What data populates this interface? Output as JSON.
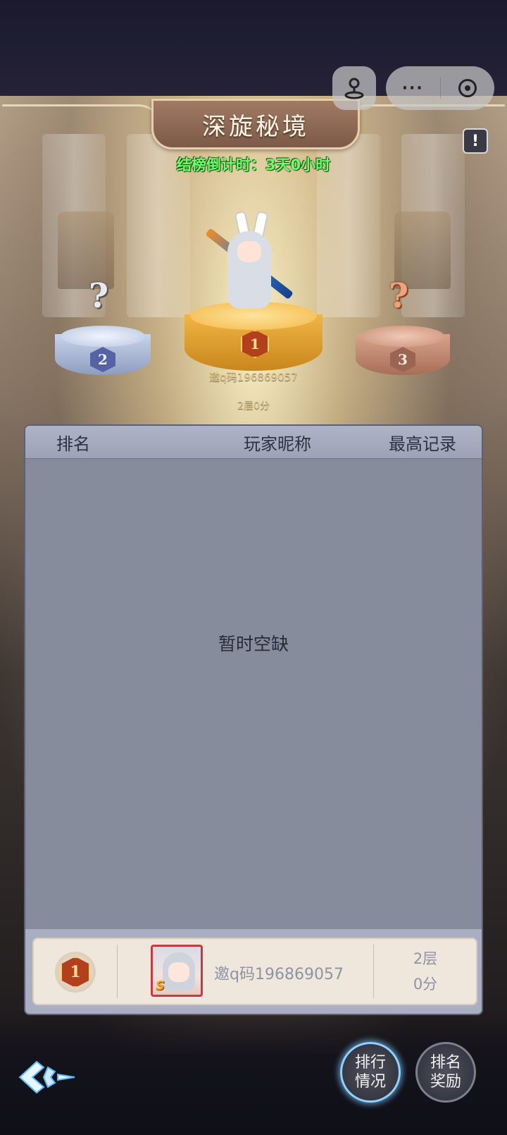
{
  "header": {
    "title": "深旋秘境",
    "countdown": "结榜倒计时：3天0小时"
  },
  "mini_program_bar": {
    "icons": [
      "joystick-icon",
      "more-dots-icon",
      "close-target-icon"
    ],
    "more_label": "···"
  },
  "info_button": {
    "label": "!"
  },
  "podium": {
    "first": {
      "rank": "1",
      "name": "邀q码196869057",
      "score": "2层0分"
    },
    "second": {
      "rank": "2",
      "name": "?",
      "unknown": true
    },
    "third": {
      "rank": "3",
      "name": "?",
      "unknown": true
    }
  },
  "ranking_table": {
    "columns": [
      "排名",
      "玩家昵称",
      "最高记录"
    ],
    "empty_text": "暂时空缺",
    "rows": []
  },
  "my_rank": {
    "rank": "1",
    "avatar_grade": "S",
    "name": "邀q码196869057",
    "floor": "2层",
    "score": "0分"
  },
  "bottom_buttons": {
    "ranking_status": {
      "line1": "排行",
      "line2": "情况"
    },
    "ranking_rewards": {
      "line1": "排名",
      "line2": "奖励"
    }
  },
  "colors": {
    "countdown_green": "#6cff6a",
    "gold": "#f1b545",
    "silver": "#c9d4ea",
    "bronze": "#d7a38b",
    "panel_bg": "#878c9c"
  }
}
